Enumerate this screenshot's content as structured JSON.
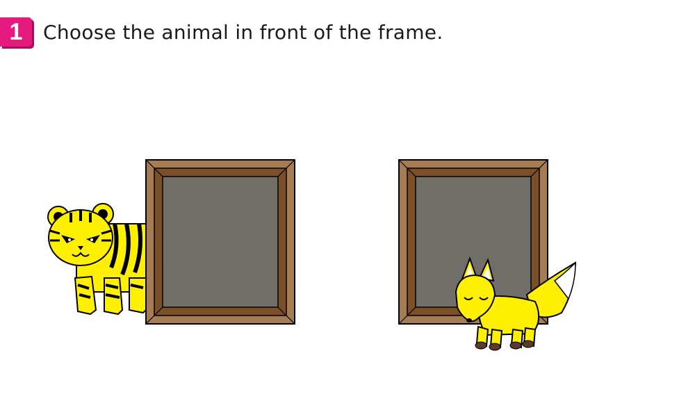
{
  "question": {
    "number": "1",
    "text": "Choose the animal in front of the frame.",
    "badge_color": "#e6197e"
  },
  "colors": {
    "frame_outer": "#a67c52",
    "frame_inner": "#7a4f2a",
    "frame_center": "#716d69",
    "animal_body": "#ffef00",
    "outline": "#000000",
    "paw_dark": "#5c3b27"
  },
  "options": [
    {
      "animal": "tiger",
      "position": "behind-frame",
      "icon": "tiger-icon"
    },
    {
      "animal": "fox",
      "position": "in-front-of-frame",
      "icon": "fox-icon"
    }
  ]
}
